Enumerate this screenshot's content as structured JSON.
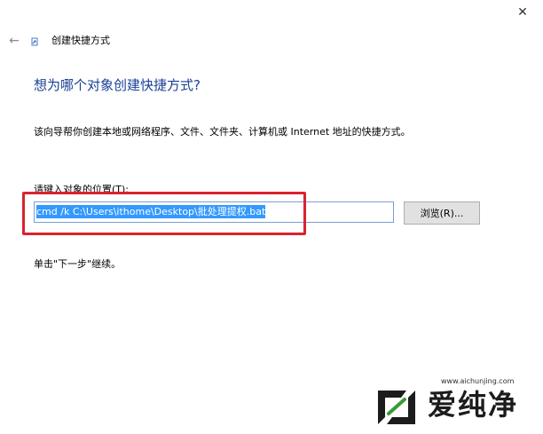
{
  "window": {
    "close_glyph": "✕",
    "back_glyph": "←",
    "title": "创建快捷方式"
  },
  "main": {
    "heading": "想为哪个对象创建快捷方式?",
    "description": "该向导帮你创建本地或网络程序、文件、文件夹、计算机或 Internet 地址的快捷方式。",
    "location_label": "请键入对象的位置(T):",
    "location_value": "cmd /k C:\\Users\\ithome\\Desktop\\批处理提权.bat",
    "browse_label": "浏览(R)...",
    "hint": "单击\"下一步\"继续。"
  },
  "watermark": {
    "url": "www.aichunjing.com",
    "brand": "爱纯净"
  },
  "colors": {
    "heading": "#1a3f96",
    "selection": "#3399ff",
    "highlight_box": "#d9232e",
    "watermark_green": "#3a9a3a"
  },
  "icons": {
    "close": "close-icon",
    "back": "back-arrow-icon",
    "title": "shortcut-icon",
    "watermark": "aichunjing-logo"
  }
}
